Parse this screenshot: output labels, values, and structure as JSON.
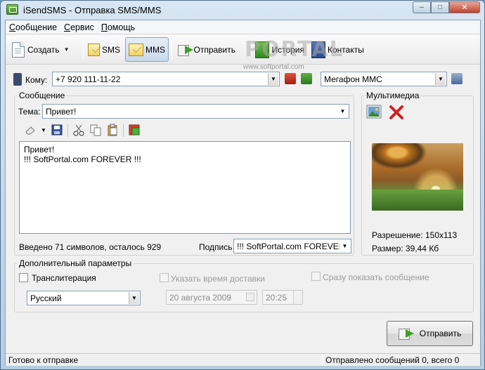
{
  "window": {
    "title": "iSendSMS - Отправка SMS/MMS",
    "controls": {
      "minimize": "–",
      "maximize": "□",
      "close": "✕"
    }
  },
  "menu": {
    "items": [
      {
        "label_u": "С",
        "label_rest": "ообщение"
      },
      {
        "label_u": "С",
        "label_rest": "ервис"
      },
      {
        "label_u": "П",
        "label_rest": "омощь"
      }
    ]
  },
  "toolbar": {
    "create": {
      "label": "Создать",
      "icon": "new-document-icon"
    },
    "sms": {
      "label": "SMS",
      "icon": "envelope-icon"
    },
    "mms": {
      "label": "MMS",
      "icon": "envelope-image-icon",
      "active": true
    },
    "send": {
      "label": "Отправить",
      "icon": "send-arrow-icon"
    },
    "history": {
      "label": "История",
      "icon": "history-icon"
    },
    "contacts": {
      "label": "Контакты",
      "icon": "address-book-icon"
    }
  },
  "watermark": {
    "text": "PORTAL",
    "url": "www.softportal.com"
  },
  "recipient": {
    "label": "Кому:",
    "value": "+7 920 111-11-22",
    "operator": "Мегафон ММС"
  },
  "message": {
    "group_title": "Сообщение",
    "subject_label": "Тема:",
    "subject_value": "Привет!",
    "body_line1": "Привет!",
    "body_line2": "!!! SoftPortal.com FOREVER !!!",
    "counter": "Введено 71 символов, осталось 929",
    "signature_label": "Подпись",
    "signature_value": "!!! SoftPortal.com FOREVER !"
  },
  "multimedia": {
    "group_title": "Мультимедиа",
    "resolution": "Разрешение: 150x113",
    "size": "Размер: 39,44 Кб"
  },
  "extra": {
    "group_title": "Дополнительный параметры",
    "transliteration": "Транслитерация",
    "language": "Русский",
    "delivery_time": "Указать время доставки",
    "date": "20  августа  2009",
    "time": "20:25",
    "flash": "Сразу показать сообщение"
  },
  "send_button": "Отправить",
  "status": {
    "left": "Готово к отправке",
    "right": "Отправлено сообщений 0, всего 0"
  },
  "colors": {
    "accent_green": "#3fa02a",
    "error_red": "#d02020"
  }
}
